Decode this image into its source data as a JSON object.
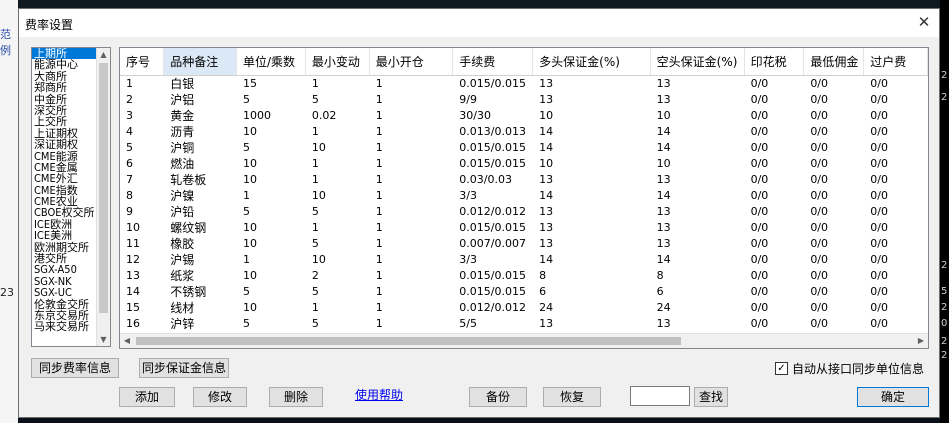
{
  "background": {
    "left_text_1": "范例",
    "left_text_2": "23",
    "right_digits": [
      "2",
      "2",
      "2",
      "5",
      "2",
      "0",
      "2",
      "2"
    ]
  },
  "dialog": {
    "title": "费率设置",
    "close_glyph": "✕"
  },
  "exchanges": {
    "selected_index": 0,
    "items": [
      "上期所",
      "能源中心",
      "大商所",
      "郑商所",
      "中金所",
      "深交所",
      "上交所",
      "上证期权",
      "深证期权",
      "CME能源",
      "CME金属",
      "CME外汇",
      "CME指数",
      "CME农业",
      "CBOE权交所",
      "ICE欧洲",
      "ICE美洲",
      "欧洲期交所",
      "港交所",
      "SGX-A50",
      "SGX-NK",
      "SGX-UC",
      "伦敦金交所",
      "东京交易所",
      "马来交易所"
    ]
  },
  "table": {
    "active_column": 1,
    "columns": [
      "序号",
      "品种备注",
      "单位/乘数",
      "最小变动",
      "最小开仓",
      "手续费",
      "多头保证金(%)",
      "空头保证金(%)",
      "印花税",
      "最低佣金",
      "过户费"
    ],
    "rows": [
      [
        "1",
        "白银",
        "15",
        "1",
        "1",
        "0.015/0.015",
        "13",
        "13",
        "0/0",
        "0/0",
        "0/0"
      ],
      [
        "2",
        "沪铝",
        "5",
        "5",
        "1",
        "9/9",
        "13",
        "13",
        "0/0",
        "0/0",
        "0/0"
      ],
      [
        "3",
        "黄金",
        "1000",
        "0.02",
        "1",
        "30/30",
        "10",
        "10",
        "0/0",
        "0/0",
        "0/0"
      ],
      [
        "4",
        "沥青",
        "10",
        "1",
        "1",
        "0.013/0.013",
        "14",
        "14",
        "0/0",
        "0/0",
        "0/0"
      ],
      [
        "5",
        "沪铜",
        "5",
        "10",
        "1",
        "0.015/0.015",
        "14",
        "14",
        "0/0",
        "0/0",
        "0/0"
      ],
      [
        "6",
        "燃油",
        "10",
        "1",
        "1",
        "0.015/0.015",
        "10",
        "10",
        "0/0",
        "0/0",
        "0/0"
      ],
      [
        "7",
        "轧卷板",
        "10",
        "1",
        "1",
        "0.03/0.03",
        "13",
        "13",
        "0/0",
        "0/0",
        "0/0"
      ],
      [
        "8",
        "沪镍",
        "1",
        "10",
        "1",
        "3/3",
        "14",
        "14",
        "0/0",
        "0/0",
        "0/0"
      ],
      [
        "9",
        "沪铅",
        "5",
        "5",
        "1",
        "0.012/0.012",
        "13",
        "13",
        "0/0",
        "0/0",
        "0/0"
      ],
      [
        "10",
        "螺纹钢",
        "10",
        "1",
        "1",
        "0.015/0.015",
        "13",
        "13",
        "0/0",
        "0/0",
        "0/0"
      ],
      [
        "11",
        "橡胶",
        "10",
        "5",
        "1",
        "0.007/0.007",
        "13",
        "13",
        "0/0",
        "0/0",
        "0/0"
      ],
      [
        "12",
        "沪锡",
        "1",
        "10",
        "1",
        "3/3",
        "14",
        "14",
        "0/0",
        "0/0",
        "0/0"
      ],
      [
        "13",
        "纸浆",
        "10",
        "2",
        "1",
        "0.015/0.015",
        "8",
        "8",
        "0/0",
        "0/0",
        "0/0"
      ],
      [
        "14",
        "不锈钢",
        "5",
        "5",
        "1",
        "0.015/0.015",
        "6",
        "6",
        "0/0",
        "0/0",
        "0/0"
      ],
      [
        "15",
        "线材",
        "10",
        "1",
        "1",
        "0.012/0.012",
        "24",
        "24",
        "0/0",
        "0/0",
        "0/0"
      ],
      [
        "16",
        "沪锌",
        "5",
        "5",
        "1",
        "5/5",
        "13",
        "13",
        "0/0",
        "0/0",
        "0/0"
      ]
    ]
  },
  "buttons": {
    "sync_fee": "同步费率信息",
    "sync_margin": "同步保证金信息",
    "add": "添加",
    "modify": "修改",
    "delete": "删除",
    "help": "使用帮助",
    "backup": "备份",
    "restore": "恢复",
    "search": "查找",
    "ok": "确定"
  },
  "search": {
    "value": ""
  },
  "auto_sync": {
    "label": "自动从接口同步单位信息",
    "checked": true
  }
}
